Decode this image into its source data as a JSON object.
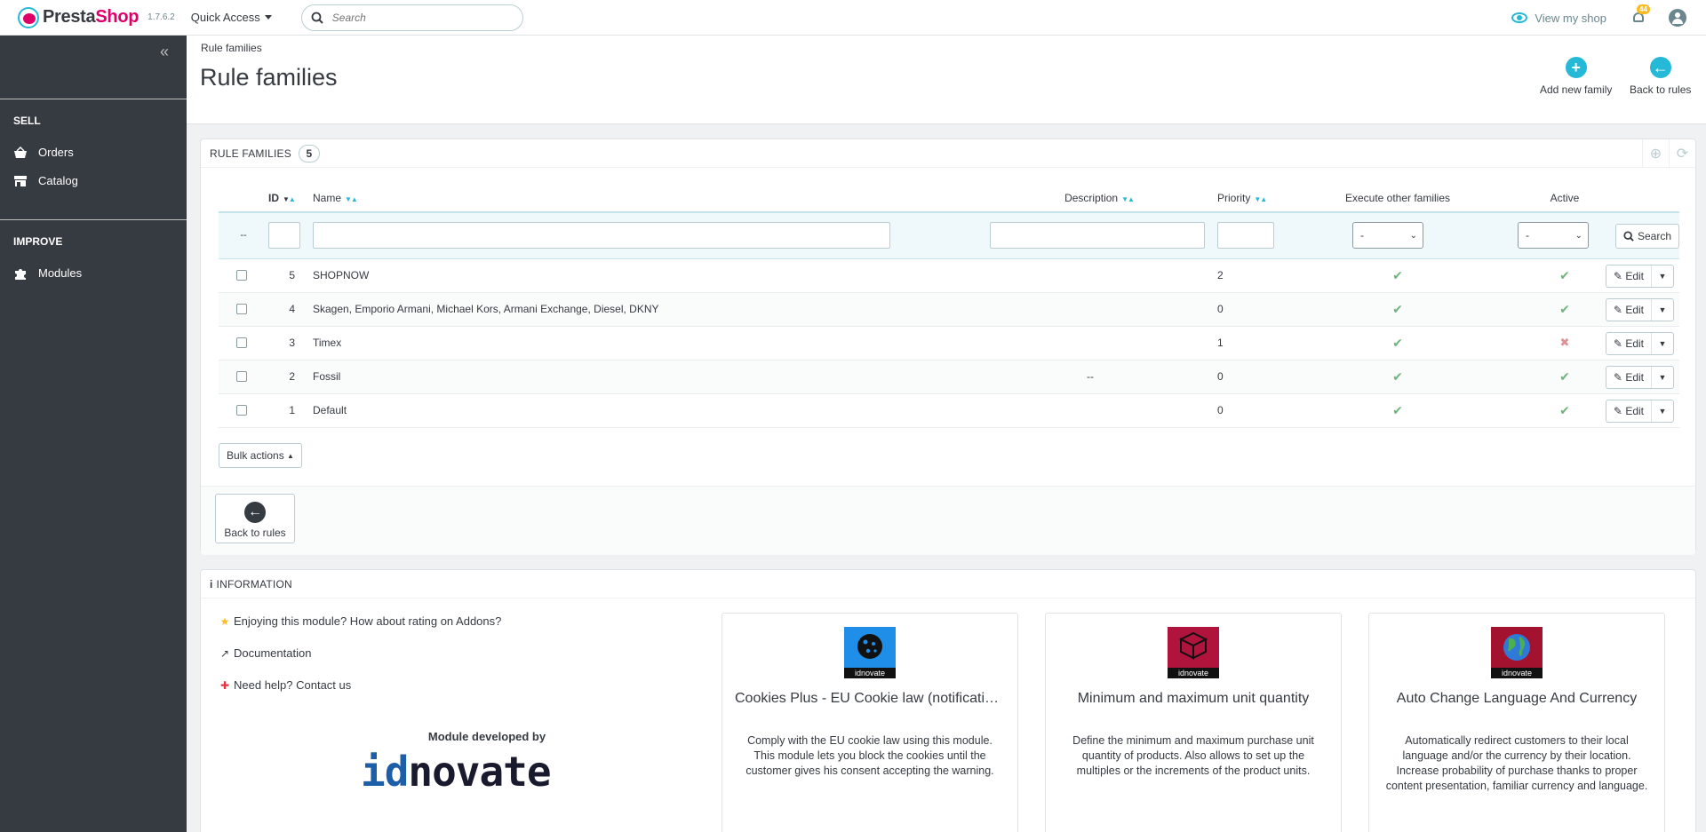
{
  "header": {
    "brand_pre": "Presta",
    "brand_shop": "Shop",
    "version": "1.7.6.2",
    "quick_access": "Quick Access",
    "search_placeholder": "Search",
    "view_shop": "View my shop",
    "notif_count": "44"
  },
  "sidebar": {
    "sections": [
      {
        "title": "SELL",
        "items": [
          {
            "label": "Orders",
            "icon": "basket-icon"
          },
          {
            "label": "Catalog",
            "icon": "store-icon"
          }
        ]
      },
      {
        "title": "IMPROVE",
        "items": [
          {
            "label": "Modules",
            "icon": "puzzle-icon"
          }
        ]
      }
    ]
  },
  "page": {
    "breadcrumb": "Rule families",
    "title": "Rule families",
    "toolbar": {
      "add_label": "Add new family",
      "back_label": "Back to rules"
    }
  },
  "panel": {
    "title": "RULE FAMILIES",
    "count": "5",
    "columns": {
      "id": "ID",
      "name": "Name",
      "description": "Description",
      "priority": "Priority",
      "execute": "Execute other families",
      "active": "Active"
    },
    "filter": {
      "dash": "--",
      "execute_value": "-",
      "active_value": "-",
      "search_label": "Search"
    },
    "rows": [
      {
        "id": "5",
        "name": "SHOPNOW",
        "description": "",
        "priority": "2",
        "execute": true,
        "active": true
      },
      {
        "id": "4",
        "name": "Skagen, Emporio Armani, Michael Kors, Armani Exchange, Diesel, DKNY",
        "description": "",
        "priority": "0",
        "execute": true,
        "active": true
      },
      {
        "id": "3",
        "name": "Timex",
        "description": "",
        "priority": "1",
        "execute": true,
        "active": false
      },
      {
        "id": "2",
        "name": "Fossil",
        "description": "--",
        "priority": "0",
        "execute": true,
        "active": true
      },
      {
        "id": "1",
        "name": "Default",
        "description": "",
        "priority": "0",
        "execute": true,
        "active": true
      }
    ],
    "edit_label": "Edit",
    "bulk_label": "Bulk actions",
    "back_label": "Back to rules"
  },
  "info": {
    "title": "INFORMATION",
    "links": {
      "rate": "Enjoying this module? How about rating on Addons?",
      "doc": "Documentation",
      "help": "Need help? Contact us"
    },
    "developed_by": "Module developed by",
    "dev_logo_a": "id",
    "dev_logo_b": "novate",
    "cards": [
      {
        "logo_label": "idnovate",
        "title": "Cookies Plus - EU Cookie law (notification)",
        "desc": "Comply with the EU cookie law using this module. This module lets you block the cookies until the customer gives his consent accepting the warning.",
        "color": "#1f8ee8"
      },
      {
        "logo_label": "idnovate",
        "title": "Minimum and maximum unit quantity",
        "desc": "Define the minimum and maximum purchase unit quantity of products. Also allows to set up the multiples or the increments of the product units.",
        "color": "#b0143c"
      },
      {
        "logo_label": "idnovate",
        "title": "Auto Change Language And Currency",
        "desc": "Automatically redirect customers to their local language and/or the currency by their location. Increase probability of purchase thanks to proper content presentation, familiar currency and language.",
        "color": "#a3122f"
      }
    ]
  }
}
